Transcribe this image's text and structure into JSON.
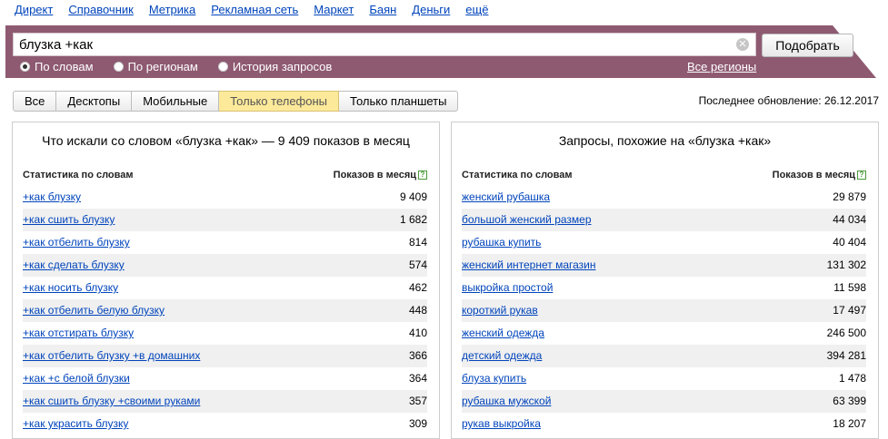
{
  "topnav": [
    "Директ",
    "Справочник",
    "Метрика",
    "Рекламная сеть",
    "Маркет",
    "Баян",
    "Деньги",
    "ещё"
  ],
  "search": {
    "value": "блузка +как",
    "button_label": "Подобрать"
  },
  "radios": [
    {
      "label": "По словам",
      "checked": true
    },
    {
      "label": "По регионам",
      "checked": false
    },
    {
      "label": "История запросов",
      "checked": false
    }
  ],
  "regions_link": "Все регионы",
  "tabs": [
    {
      "label": "Все",
      "active": false
    },
    {
      "label": "Десктопы",
      "active": false
    },
    {
      "label": "Мобильные",
      "active": false
    },
    {
      "label": "Только телефоны",
      "active": true
    },
    {
      "label": "Только планшеты",
      "active": false
    }
  ],
  "updated": "Последнее обновление: 26.12.2017",
  "colors": {
    "band": "#8e5a71",
    "link": "#0044bb",
    "active_tab": "#fde99a"
  },
  "chart_data": [
    {
      "type": "table",
      "title": "Что искали со словом «блузка +как» — 9 409 показов в месяц",
      "col_phrase": "Статистика по словам",
      "col_count": "Показов в месяц",
      "rows": [
        {
          "phrase": "+как блузку",
          "count": "9 409"
        },
        {
          "phrase": "+как сшить блузку",
          "count": "1 682"
        },
        {
          "phrase": "+как отбелить блузку",
          "count": "814"
        },
        {
          "phrase": "+как сделать блузку",
          "count": "574"
        },
        {
          "phrase": "+как носить блузку",
          "count": "462"
        },
        {
          "phrase": "+как отбелить белую блузку",
          "count": "448"
        },
        {
          "phrase": "+как отстирать блузку",
          "count": "410"
        },
        {
          "phrase": "+как отбелить блузку +в домашних",
          "count": "366"
        },
        {
          "phrase": "+как +с белой блузки",
          "count": "364"
        },
        {
          "phrase": "+как сшить блузку +своими руками",
          "count": "357"
        },
        {
          "phrase": "+как украсить блузку",
          "count": "309"
        }
      ]
    },
    {
      "type": "table",
      "title": "Запросы, похожие на «блузка +как»",
      "col_phrase": "Статистика по словам",
      "col_count": "Показов в месяц",
      "rows": [
        {
          "phrase": "женский рубашка",
          "count": "29 879"
        },
        {
          "phrase": "большой женский размер",
          "count": "44 034"
        },
        {
          "phrase": "рубашка купить",
          "count": "40 404"
        },
        {
          "phrase": "женский интернет магазин",
          "count": "131 302"
        },
        {
          "phrase": "выкройка простой",
          "count": "11 598"
        },
        {
          "phrase": "короткий рукав",
          "count": "17 497"
        },
        {
          "phrase": "женский одежда",
          "count": "246 500"
        },
        {
          "phrase": "детский одежда",
          "count": "394 281"
        },
        {
          "phrase": "блуза купить",
          "count": "1 478"
        },
        {
          "phrase": "рубашка мужской",
          "count": "63 399"
        },
        {
          "phrase": "рукав выкройка",
          "count": "18 207"
        }
      ]
    }
  ]
}
